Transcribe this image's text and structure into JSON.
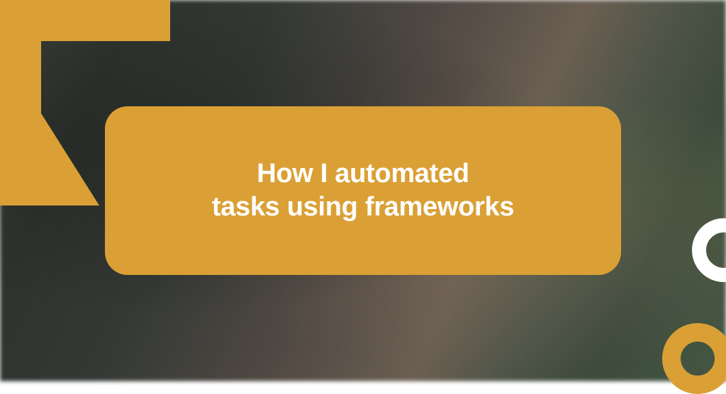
{
  "title": {
    "line1": "How I automated",
    "line2": "tasks using frameworks"
  },
  "colors": {
    "accent": "#daa035",
    "text": "#ffffff"
  }
}
